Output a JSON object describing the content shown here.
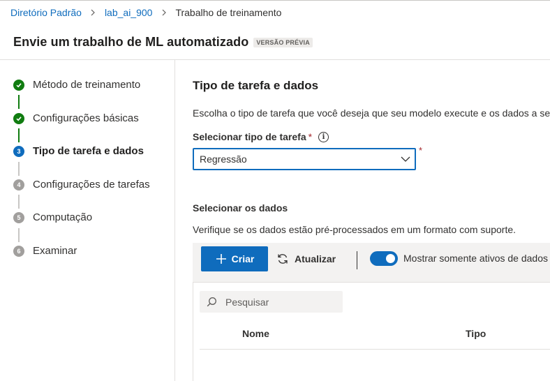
{
  "breadcrumb": {
    "items": [
      "Diretório Padrão",
      "lab_ai_900"
    ],
    "current": "Trabalho de treinamento"
  },
  "header": {
    "title": "Envie um trabalho de ML automatizado",
    "badge": "VERSÃO PRÉVIA"
  },
  "steps": [
    {
      "label": "Método de treinamento",
      "status": "done"
    },
    {
      "label": "Configurações básicas",
      "status": "done"
    },
    {
      "label": "Tipo de tarefa e dados",
      "status": "current",
      "number": "3"
    },
    {
      "label": "Configurações de tarefas",
      "status": "pending",
      "number": "4"
    },
    {
      "label": "Computação",
      "status": "pending",
      "number": "5"
    },
    {
      "label": "Examinar",
      "status": "pending",
      "number": "6"
    }
  ],
  "main": {
    "title": "Tipo de tarefa e dados",
    "description": "Escolha o tipo de tarefa que você deseja que seu modelo execute e os dados a serem usados",
    "task_type_label": "Selecionar tipo de tarefa",
    "required_mark": "*",
    "task_type_value": "Regressão",
    "data_title": "Selecionar os dados",
    "data_description": "Verifique se os dados estão pré-processados em um formato com suporte."
  },
  "toolbar": {
    "create_label": "Criar",
    "refresh_label": "Atualizar",
    "toggle_label": "Mostrar somente ativos de dados",
    "toggle_on": true
  },
  "grid": {
    "search_placeholder": "Pesquisar",
    "columns": [
      "Nome",
      "Tipo"
    ]
  },
  "colors": {
    "accent": "#0f6cbd",
    "success": "#107c10",
    "required": "#a4262c"
  },
  "icons": [
    "chevron-right-icon",
    "check-icon",
    "info-icon",
    "chevron-down-icon",
    "plus-icon",
    "refresh-icon",
    "search-icon"
  ]
}
